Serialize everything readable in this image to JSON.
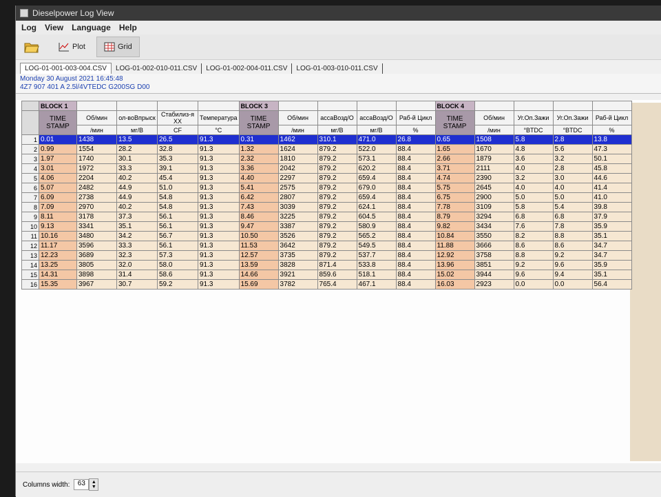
{
  "window_title": "Dieselpower Log View",
  "menu": [
    "Log",
    "View",
    "Language",
    "Help"
  ],
  "toolbar": {
    "plot_label": "Plot",
    "grid_label": "Grid"
  },
  "tabs": [
    "LOG-01-001-003-004.CSV",
    "LOG-01-002-010-011.CSV",
    "LOG-01-002-004-011.CSV",
    "LOG-01-003-010-011.CSV"
  ],
  "info": {
    "date": "Monday 30 August 2021 16:45:48",
    "ecu": "4Z7 907 401 A  2.5l/4VTEDC G200SG D00"
  },
  "blocks": [
    "BLOCK 1",
    "BLOCK 3",
    "BLOCK 4"
  ],
  "headers": {
    "ts": "TIME STAMP",
    "b1": [
      "Об/мин",
      "ол-воВпрыск",
      "Стабилиз-я XX",
      "Температура"
    ],
    "b1_units": [
      "/мин",
      "мг/В",
      "CF",
      "°C"
    ],
    "b3": [
      "Об/мин",
      "ассаВозд/О",
      "ассаВозд/О",
      "Раб-й Цикл"
    ],
    "b3_units": [
      "/мин",
      "мг/В",
      "мг/В",
      "%"
    ],
    "b4": [
      "Об/мин",
      "Уг.Оп.Зажи",
      "Уг.Оп.Зажи",
      "Раб-й Цикл"
    ],
    "b4_units": [
      "/мин",
      "°BTDC",
      "°BTDC",
      "%"
    ]
  },
  "rows": [
    [
      "1",
      "0.01",
      "1438",
      "13.5",
      "26.5",
      "91.3",
      "0.31",
      "1462",
      "310.1",
      "471.0",
      "26.8",
      "0.65",
      "1508",
      "5.8",
      "2.8",
      "13.8"
    ],
    [
      "2",
      "0.99",
      "1554",
      "28.2",
      "32.8",
      "91.3",
      "1.32",
      "1624",
      "879.2",
      "522.0",
      "88.4",
      "1.65",
      "1670",
      "4.8",
      "5.6",
      "47.3"
    ],
    [
      "3",
      "1.97",
      "1740",
      "30.1",
      "35.3",
      "91.3",
      "2.32",
      "1810",
      "879.2",
      "573.1",
      "88.4",
      "2.66",
      "1879",
      "3.6",
      "3.2",
      "50.1"
    ],
    [
      "4",
      "3.01",
      "1972",
      "33.3",
      "39.1",
      "91.3",
      "3.36",
      "2042",
      "879.2",
      "620.2",
      "88.4",
      "3.71",
      "2111",
      "4.0",
      "2.8",
      "45.8"
    ],
    [
      "5",
      "4.06",
      "2204",
      "40.2",
      "45.4",
      "91.3",
      "4.40",
      "2297",
      "879.2",
      "659.4",
      "88.4",
      "4.74",
      "2390",
      "3.2",
      "3.0",
      "44.6"
    ],
    [
      "6",
      "5.07",
      "2482",
      "44.9",
      "51.0",
      "91.3",
      "5.41",
      "2575",
      "879.2",
      "679.0",
      "88.4",
      "5.75",
      "2645",
      "4.0",
      "4.0",
      "41.4"
    ],
    [
      "7",
      "6.09",
      "2738",
      "44.9",
      "54.8",
      "91.3",
      "6.42",
      "2807",
      "879.2",
      "659.4",
      "88.4",
      "6.75",
      "2900",
      "5.0",
      "5.0",
      "41.0"
    ],
    [
      "8",
      "7.09",
      "2970",
      "40.2",
      "54.8",
      "91.3",
      "7.43",
      "3039",
      "879.2",
      "624.1",
      "88.4",
      "7.78",
      "3109",
      "5.8",
      "5.4",
      "39.8"
    ],
    [
      "9",
      "8.11",
      "3178",
      "37.3",
      "56.1",
      "91.3",
      "8.46",
      "3225",
      "879.2",
      "604.5",
      "88.4",
      "8.79",
      "3294",
      "6.8",
      "6.8",
      "37.9"
    ],
    [
      "10",
      "9.13",
      "3341",
      "35.1",
      "56.1",
      "91.3",
      "9.47",
      "3387",
      "879.2",
      "580.9",
      "88.4",
      "9.82",
      "3434",
      "7.6",
      "7.8",
      "35.9"
    ],
    [
      "11",
      "10.16",
      "3480",
      "34.2",
      "56.7",
      "91.3",
      "10.50",
      "3526",
      "879.2",
      "565.2",
      "88.4",
      "10.84",
      "3550",
      "8.2",
      "8.8",
      "35.1"
    ],
    [
      "12",
      "11.17",
      "3596",
      "33.3",
      "56.1",
      "91.3",
      "11.53",
      "3642",
      "879.2",
      "549.5",
      "88.4",
      "11.88",
      "3666",
      "8.6",
      "8.6",
      "34.7"
    ],
    [
      "13",
      "12.23",
      "3689",
      "32.3",
      "57.3",
      "91.3",
      "12.57",
      "3735",
      "879.2",
      "537.7",
      "88.4",
      "12.92",
      "3758",
      "8.8",
      "9.2",
      "34.7"
    ],
    [
      "14",
      "13.25",
      "3805",
      "32.0",
      "58.0",
      "91.3",
      "13.59",
      "3828",
      "871.4",
      "533.8",
      "88.4",
      "13.96",
      "3851",
      "9.2",
      "9.6",
      "35.9"
    ],
    [
      "15",
      "14.31",
      "3898",
      "31.4",
      "58.6",
      "91.3",
      "14.66",
      "3921",
      "859.6",
      "518.1",
      "88.4",
      "15.02",
      "3944",
      "9.6",
      "9.4",
      "35.1"
    ],
    [
      "16",
      "15.35",
      "3967",
      "30.7",
      "59.2",
      "91.3",
      "15.69",
      "3782",
      "765.4",
      "467.1",
      "88.4",
      "16.03",
      "2923",
      "0.0",
      "0.0",
      "56.4"
    ]
  ],
  "status": {
    "columns_width_label": "Columns width:",
    "columns_width_value": "63"
  }
}
